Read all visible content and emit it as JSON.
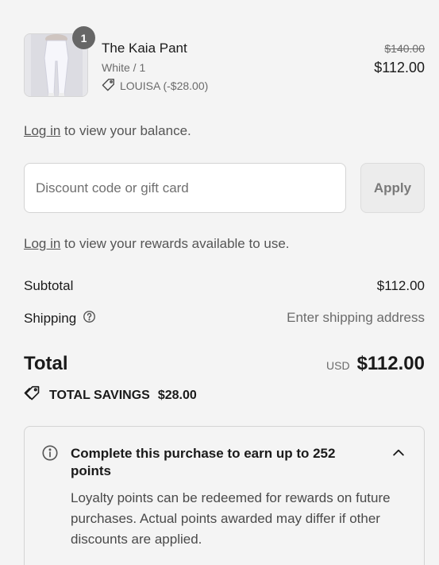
{
  "product": {
    "quantity": "1",
    "name": "The Kaia Pant",
    "variant": "White / 1",
    "discount_label": "LOUISA (-$28.00)",
    "original_price": "$140.00",
    "price": "$112.00"
  },
  "balance_login": {
    "link": "Log in",
    "text": " to view your balance."
  },
  "discount": {
    "placeholder": "Discount code or gift card",
    "apply_label": "Apply"
  },
  "rewards_login": {
    "link": "Log in",
    "text": " to view your rewards available to use."
  },
  "summary": {
    "subtotal_label": "Subtotal",
    "subtotal_value": "$112.00",
    "shipping_label": "Shipping",
    "shipping_value": "Enter shipping address"
  },
  "total": {
    "label": "Total",
    "currency": "USD",
    "amount": "$112.00"
  },
  "savings": {
    "label": "TOTAL SAVINGS",
    "amount": "$28.00"
  },
  "loyalty": {
    "title": "Complete this purchase to earn up to 252 points",
    "body": "Loyalty points can be redeemed for rewards on future purchases. Actual points awarded may differ if other discounts are applied."
  },
  "colors": {
    "background": "#f4f4f4",
    "badge": "#666666",
    "muted_text": "#6b6b6b"
  },
  "icons": [
    "tag-icon",
    "help-circle-icon",
    "savings-tag-icon",
    "info-icon",
    "chevron-up-icon"
  ]
}
